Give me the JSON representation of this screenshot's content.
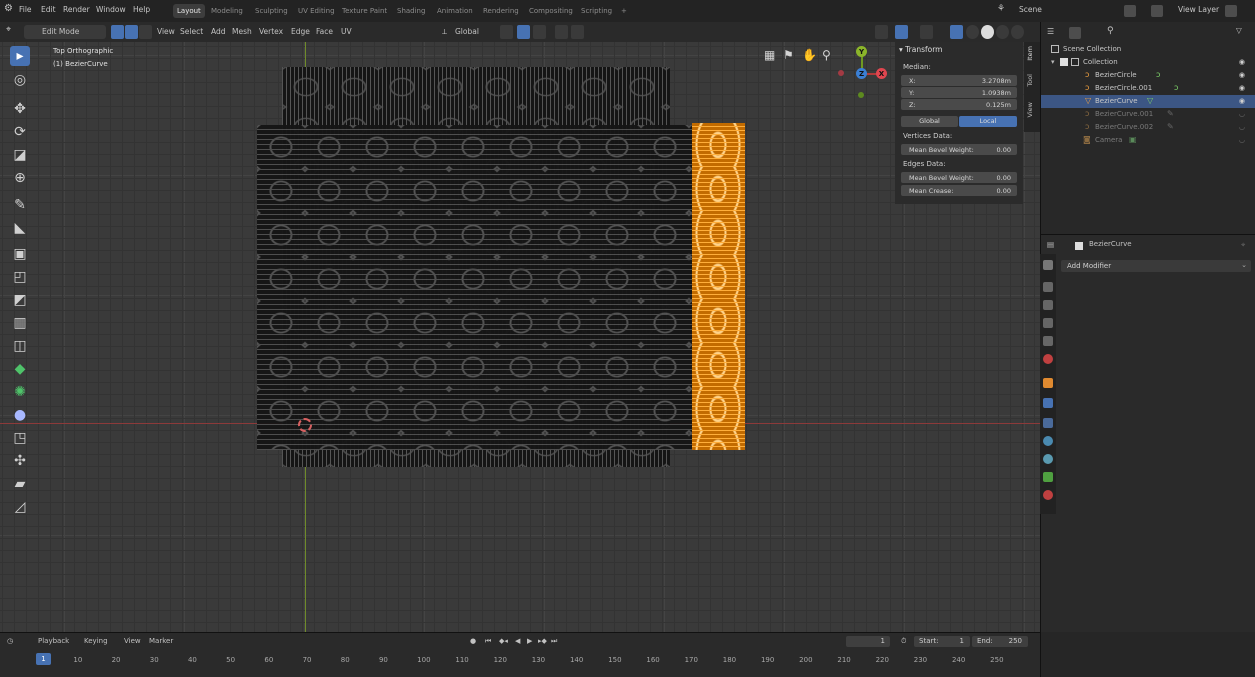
{
  "menu": {
    "items": [
      "File",
      "Edit",
      "Render",
      "Window",
      "Help"
    ],
    "workspaces": [
      "Layout",
      "Modeling",
      "Sculpting",
      "UV Editing",
      "Texture Paint",
      "Shading",
      "Animation",
      "Rendering",
      "Compositing",
      "Scripting"
    ],
    "active_workspace": "Layout",
    "add_tab": "+",
    "scene": "Scene",
    "view_layer": "View Layer"
  },
  "header": {
    "mode": "Edit Mode",
    "menus": [
      "View",
      "Select",
      "Add",
      "Mesh",
      "Vertex",
      "Edge",
      "Face",
      "UV"
    ],
    "orientation": "Global"
  },
  "viewport": {
    "view_name": "Top Orthographic",
    "object_label": "(1) BezierCurve",
    "gizmo": {
      "x": "X",
      "y": "Y",
      "z": "Z"
    }
  },
  "npanel": {
    "title": "Transform",
    "median_label": "Median:",
    "x": {
      "label": "X:",
      "value": "3.2708m"
    },
    "y": {
      "label": "Y:",
      "value": "1.0938m"
    },
    "z": {
      "label": "Z:",
      "value": "0.125m"
    },
    "global": "Global",
    "local": "Local",
    "vertices_data": "Vertices Data:",
    "mean_bevel_weight_v": {
      "label": "Mean Bevel Weight:",
      "value": "0.00"
    },
    "edges_data": "Edges Data:",
    "mean_bevel_weight_e": {
      "label": "Mean Bevel Weight:",
      "value": "0.00"
    },
    "mean_crease": {
      "label": "Mean Crease:",
      "value": "0.00"
    },
    "tabs": [
      "Item",
      "Tool",
      "View"
    ]
  },
  "outliner": {
    "root": "Scene Collection",
    "collection": "Collection",
    "items": [
      {
        "name": "BezierCircle",
        "selected": false,
        "dim": false
      },
      {
        "name": "BezierCircle.001",
        "selected": false,
        "dim": false
      },
      {
        "name": "BezierCurve",
        "selected": true,
        "dim": false
      },
      {
        "name": "BezierCurve.001",
        "selected": false,
        "dim": true
      },
      {
        "name": "BezierCurve.002",
        "selected": false,
        "dim": true
      },
      {
        "name": "Camera",
        "selected": false,
        "dim": true
      }
    ]
  },
  "properties": {
    "object_name": "BezierCurve",
    "add_modifier": "Add Modifier"
  },
  "timeline": {
    "menus": [
      "Playback",
      "Keying",
      "View",
      "Marker"
    ],
    "current_frame": "1",
    "start_label": "Start:",
    "start": "1",
    "end_label": "End:",
    "end": "250",
    "ticks": [
      "10",
      "20",
      "30",
      "40",
      "50",
      "60",
      "70",
      "80",
      "90",
      "100",
      "110",
      "120",
      "130",
      "140",
      "150",
      "160",
      "170",
      "180",
      "190",
      "200",
      "210",
      "220",
      "230",
      "240",
      "250"
    ]
  },
  "colors": {
    "accent": "#4772b3",
    "selection": "#ff8c00",
    "axis_x": "#8d3a3a",
    "axis_y": "#6f8b2a"
  }
}
